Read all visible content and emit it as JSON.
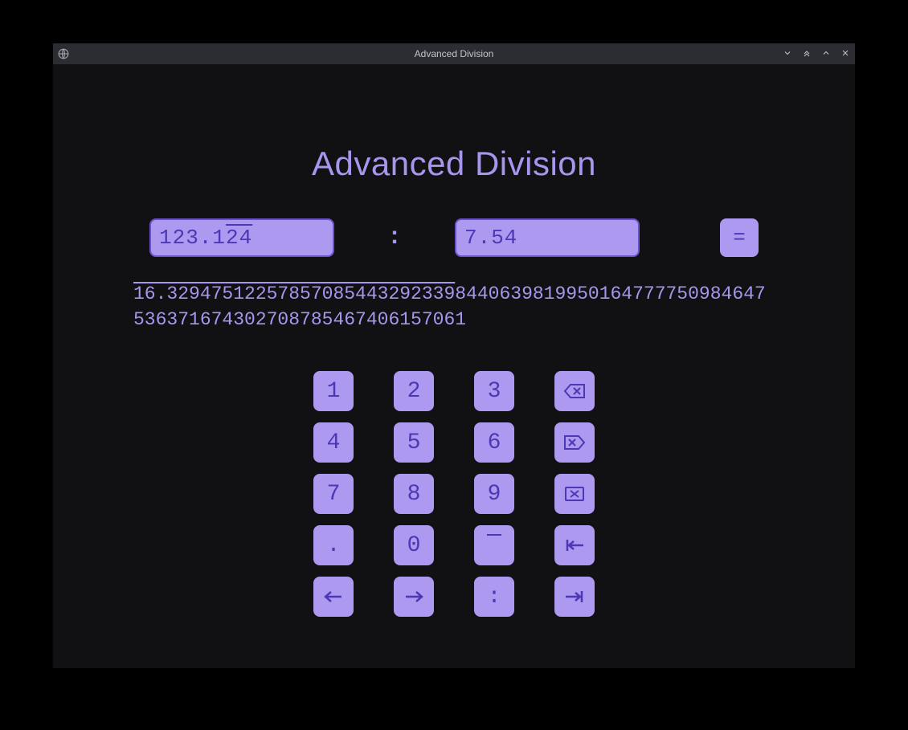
{
  "window": {
    "title": "Advanced Division"
  },
  "heading": "Advanced Division",
  "dividend": {
    "prefix": "123.1",
    "overline": "24"
  },
  "separator": ":",
  "divisor": "7.54",
  "equals_label": "=",
  "result": {
    "overline_part": "16.32947512257857085443292339",
    "rest": "8440639819950164777750984647536371674302708785467406157061"
  },
  "keypad": {
    "r1": {
      "b1": "1",
      "b2": "2",
      "b3": "3"
    },
    "r2": {
      "b1": "4",
      "b2": "5",
      "b3": "6"
    },
    "r3": {
      "b1": "7",
      "b2": "8",
      "b3": "9"
    },
    "r4": {
      "b1": ".",
      "b2": "0"
    },
    "r5": {
      "b3": ":"
    }
  }
}
